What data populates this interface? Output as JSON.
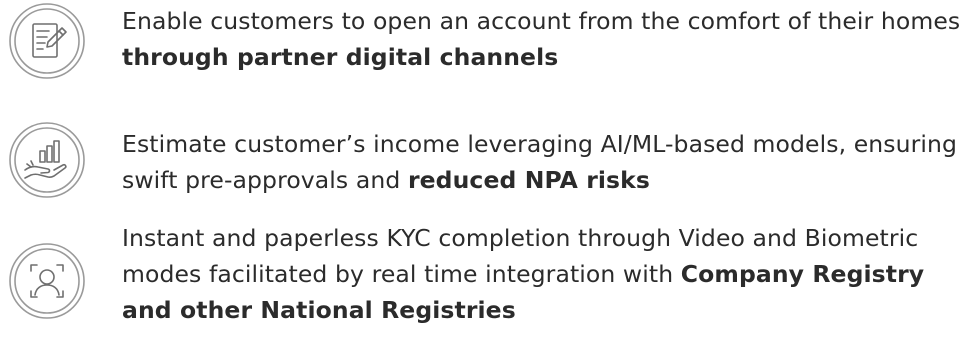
{
  "features": [
    {
      "icon": "form-edit-icon",
      "text": "Enable customers to open an account from the comfort of their homes ",
      "bold": "through partner digital channels"
    },
    {
      "icon": "hand-growth-chart-icon",
      "text": "Estimate customer’s income leveraging  AI/ML-based models, ensuring swift  pre-approvals and ",
      "bold": "reduced NPA risks"
    },
    {
      "icon": "face-scan-icon",
      "text": "Instant and paperless KYC completion through Video and Biometric modes facilitated by real time integration with ",
      "bold": "Company Registry and other National Registries"
    }
  ],
  "colors": {
    "icon_stroke": "#6f6f6f",
    "icon_circle": "#9a9a9a",
    "text": "#2b2b2b"
  }
}
